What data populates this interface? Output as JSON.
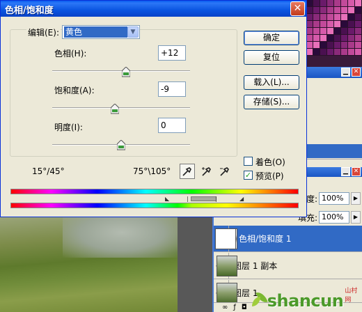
{
  "dialog": {
    "title": "色相/饱和度",
    "close_glyph": "✕",
    "edit_label": "编辑(E):",
    "edit_value": "黄色",
    "hue_label": "色相(H):",
    "hue_value": "+12",
    "hue_level": 0.535,
    "saturation_label": "饱和度(A):",
    "saturation_value": "-9",
    "saturation_level": 0.455,
    "lightness_label": "明度(I):",
    "lightness_value": "0",
    "lightness_level": 0.5,
    "ok_label": "确定",
    "reset_label": "复位",
    "load_label": "载入(L)...",
    "save_label": "存储(S)...",
    "colorize_label": "着色(O)",
    "colorize_checked": false,
    "preview_label": "预览(P)",
    "preview_checked": true,
    "range_left": "15°/45°",
    "range_right": "75°\\105°",
    "eyedroppers": [
      "eyedropper-icon",
      "eyedropper-plus-icon",
      "eyedropper-minus-icon"
    ]
  },
  "layers_panel": {
    "opacity_label": "度:",
    "opacity_value": "100%",
    "fill_label": "填充:",
    "fill_value": "100%",
    "layers": [
      {
        "name": "色相/饱和度 1",
        "selected": true,
        "type": "adjustment"
      },
      {
        "name": "图层 1 副本",
        "selected": false,
        "type": "photo"
      },
      {
        "name": "图层 1",
        "selected": false,
        "type": "photo"
      }
    ]
  },
  "watermark": {
    "text": "shancun",
    "sub": ".net",
    "small": "山村网"
  },
  "colors": {
    "title_bar": "#0a54e0",
    "dialog_bg": "#ece9d8",
    "selection": "#316ac5",
    "check_green": "#21a121"
  }
}
